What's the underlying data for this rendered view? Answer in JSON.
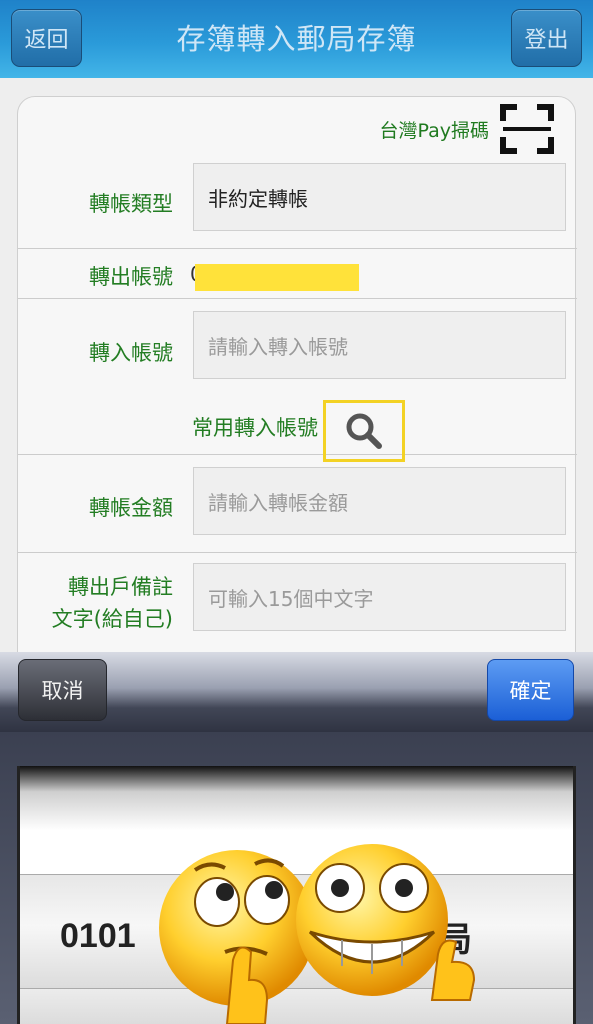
{
  "header": {
    "back_label": "返回",
    "title": "存簿轉入郵局存簿",
    "logout_label": "登出"
  },
  "form": {
    "pay_scan_label": "台灣Pay掃碼",
    "transfer_type": {
      "label": "轉帳類型",
      "value": "非約定轉帳"
    },
    "from_account": {
      "label": "轉出帳號",
      "prefix": "0"
    },
    "to_account": {
      "label": "轉入帳號",
      "placeholder": "請輸入轉入帳號"
    },
    "common_account_label": "常用轉入帳號",
    "amount": {
      "label": "轉帳金額",
      "placeholder": "請輸入轉帳金額"
    },
    "memo": {
      "label_line1": "轉出戶備註",
      "label_line2": "文字(給自己)",
      "placeholder": "可輸入15個中文字"
    }
  },
  "picker": {
    "cancel_label": "取消",
    "ok_label": "確定",
    "selected_left": "0101",
    "selected_right": "局"
  },
  "colors": {
    "header_blue": "#2a9ad9",
    "label_green": "#237d23",
    "mask_yellow": "#ffe23a",
    "ok_blue": "#1b5fd6"
  },
  "icons": [
    "scan-qr-icon",
    "search-icon",
    "thinking-emoji",
    "grinning-thumbs-up-emoji"
  ]
}
